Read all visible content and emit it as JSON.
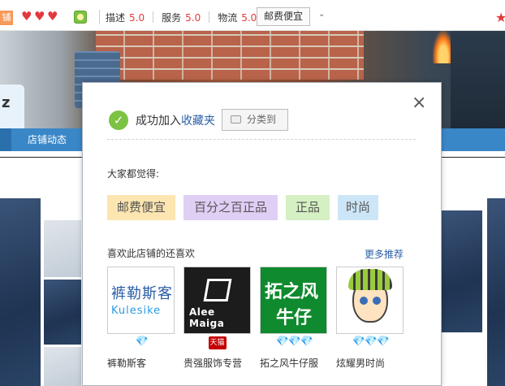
{
  "topbar": {
    "shop_tag": "铺",
    "hearts": [
      "♥",
      "♥",
      "♥"
    ],
    "ratings": [
      {
        "label": "描述",
        "score": "5.0"
      },
      {
        "label": "服务",
        "score": "5.0"
      },
      {
        "label": "物流",
        "score": "5.0"
      }
    ],
    "tag_button": "邮费便宜",
    "caret": "⌄",
    "star": "★"
  },
  "banner": {
    "promo_text": "z"
  },
  "nav": {
    "item": "店铺动态"
  },
  "dialog": {
    "close": "×",
    "ok_icon": "✓",
    "success_prefix": "成功加入",
    "success_link": "收藏夹",
    "classify_button": "分类到",
    "everyone_thinks": "大家都觉得:",
    "tags": [
      {
        "label": "邮费便宜",
        "bg": "#fce5b0"
      },
      {
        "label": "百分之百正品",
        "bg": "#e0cff5"
      },
      {
        "label": "正品",
        "bg": "#d5f0c2"
      },
      {
        "label": "时尚",
        "bg": "#cde6f7"
      }
    ],
    "also_like": "喜欢此店铺的还喜欢",
    "more": "更多推荐",
    "shops": [
      {
        "name": "裤勒斯客",
        "logo_text_1": "裤勒斯客",
        "logo_text_2": "Kulesike",
        "badge": "diamond1"
      },
      {
        "name": "贵强服饰专营",
        "logo_text_1": "Alee Maiga",
        "badge": "tmall",
        "badge_text": "天猫"
      },
      {
        "name": "拓之风牛仔服",
        "logo_text_1": "拓之风",
        "logo_text_2": "牛仔",
        "badge": "diamond3"
      },
      {
        "name": "炫耀男时尚",
        "badge": "diamond3"
      }
    ],
    "diamond": "💎"
  }
}
